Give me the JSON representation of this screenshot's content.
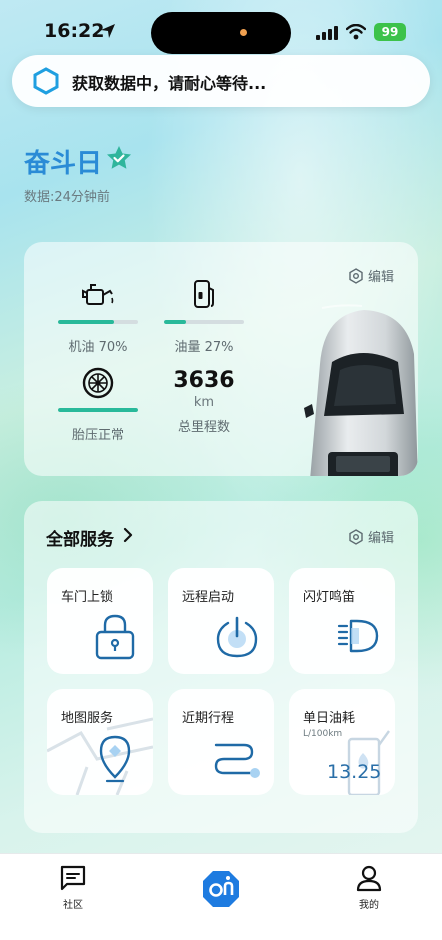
{
  "status_bar": {
    "time": "16:22",
    "battery": "99",
    "icons": [
      "location-arrow-icon",
      "cellular-signal-icon",
      "wifi-icon",
      "battery-icon"
    ]
  },
  "notice": {
    "text": "获取数据中，请耐心等待..."
  },
  "header": {
    "title": "奋斗日",
    "updated": "数据:24分钟前"
  },
  "vehicle": {
    "edit_label": "编辑",
    "oil": {
      "label": "机油 70%",
      "level": 0.7
    },
    "fuel": {
      "label": "油量 27%",
      "level": 0.27
    },
    "tire": {
      "label": "胎压正常",
      "level": 1.0
    },
    "mileage": {
      "value": "3636",
      "unit": "km",
      "label": "总里程数"
    }
  },
  "services": {
    "title": "全部服务",
    "edit_label": "编辑",
    "tiles": [
      {
        "label": "车门上锁",
        "icon": "lock-icon"
      },
      {
        "label": "远程启动",
        "icon": "power-icon"
      },
      {
        "label": "闪灯鸣笛",
        "icon": "headlight-icon"
      },
      {
        "label": "地图服务",
        "icon": "map-pin-icon"
      },
      {
        "label": "近期行程",
        "icon": "route-icon"
      },
      {
        "label": "单日油耗",
        "icon": "fuel-pump-icon",
        "unit": "L/100km",
        "value": "13.25"
      }
    ]
  },
  "tabbar": {
    "community": "社区",
    "me": "我的"
  },
  "colors": {
    "accent_blue": "#2a8bd6",
    "progress_green": "#28b99a",
    "battery_green": "#3cc24a"
  }
}
